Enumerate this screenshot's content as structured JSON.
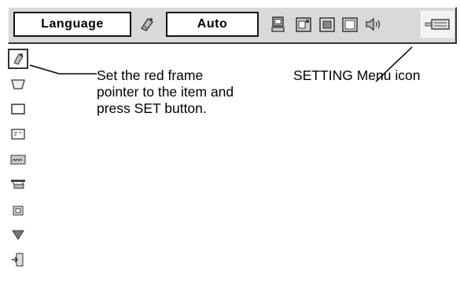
{
  "menu_bar": {
    "language_label": "Language",
    "language_value": "Auto",
    "icons": [
      "menu-pointer-icon",
      "computer-icon",
      "image-select-icon",
      "image-adjust-icon",
      "screen-icon",
      "sound-icon",
      "setting-icon"
    ]
  },
  "side_menu": {
    "items": [
      "setting-menu-icon",
      "keystone-icon",
      "blue-back-icon",
      "display-icon",
      "logo-icon",
      "ceiling-icon",
      "rear-icon",
      "terminal-icon",
      "exit-icon"
    ],
    "selected_index": 0
  },
  "annotations": {
    "instruction_lines": [
      "Set the red frame",
      "pointer to the item and",
      "press SET button."
    ],
    "setting_callout": "SETTING Menu icon"
  }
}
